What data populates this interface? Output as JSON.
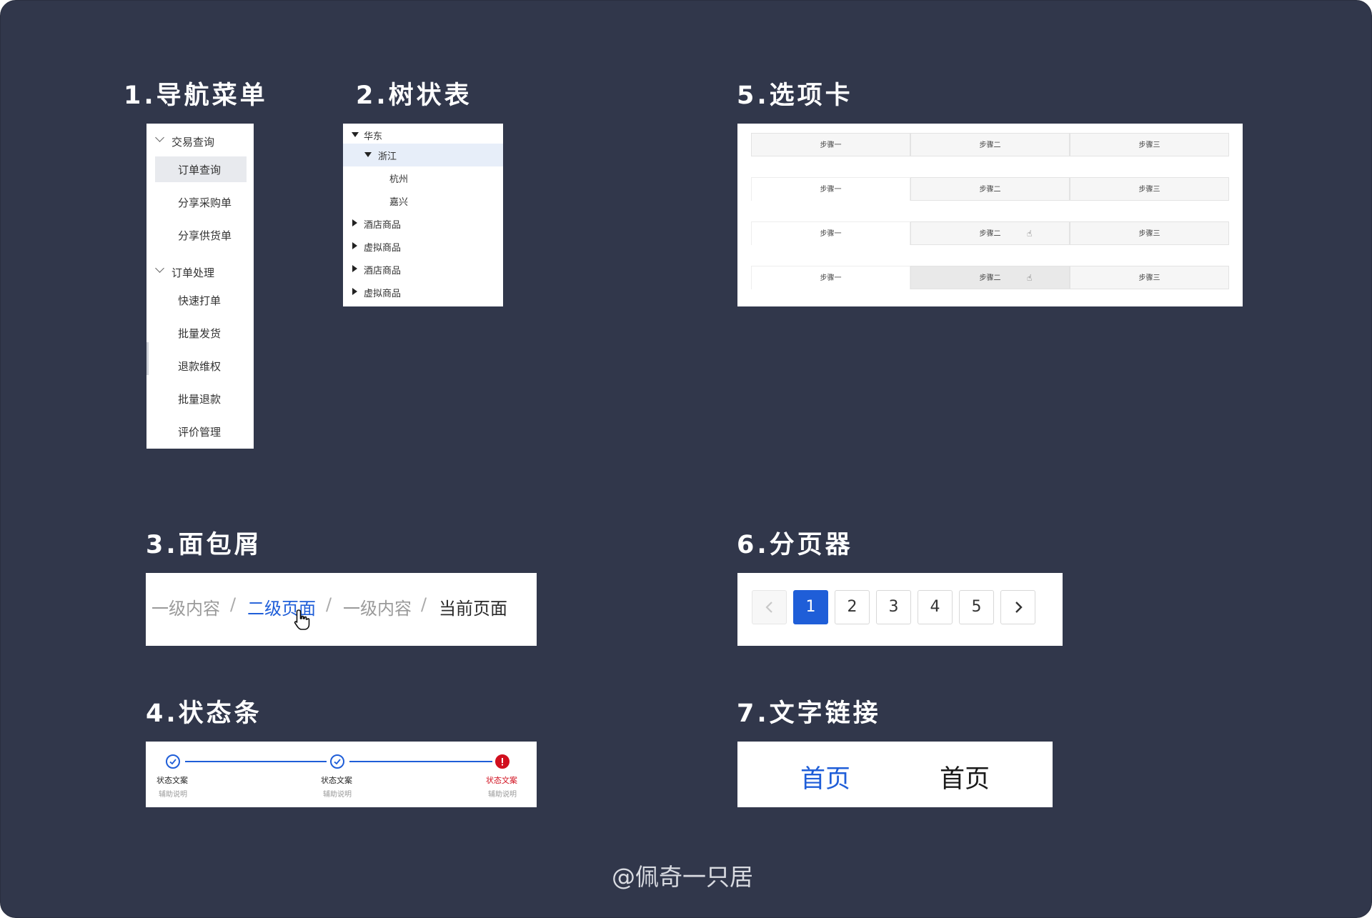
{
  "headings": {
    "nav": "1.导航菜单",
    "tree": "2.树状表",
    "breadcrumb": "3.面包屑",
    "steps": "4.状态条",
    "tabs": "5.选项卡",
    "pager": "6.分页器",
    "links": "7.文字链接"
  },
  "nav": {
    "groups": [
      "交易查询",
      "订单处理"
    ],
    "items": [
      "订单查询",
      "分享采购单",
      "分享供货单",
      "快速打单",
      "批量发货",
      "退款维权",
      "批量退款",
      "评价管理"
    ]
  },
  "tree": [
    "华东",
    "浙江",
    "杭州",
    "嘉兴",
    "酒店商品",
    "虚拟商品",
    "酒店商品",
    "虚拟商品"
  ],
  "tabs": {
    "labels": [
      "步骤一",
      "步骤二",
      "步骤三"
    ]
  },
  "breadcrumb": {
    "items": [
      "一级内容",
      "二级页面",
      "一级内容",
      "当前页面"
    ],
    "separator": "/"
  },
  "steps": [
    {
      "title": "状态文案",
      "sub": "辅助说明"
    },
    {
      "title": "状态文案",
      "sub": "辅助说明"
    },
    {
      "title": "状态文案",
      "sub": "辅助说明"
    }
  ],
  "pager": {
    "pages": [
      "1",
      "2",
      "3",
      "4",
      "5"
    ],
    "current": 1
  },
  "links": [
    "首页",
    "首页"
  ],
  "colors": {
    "background": "#31374b",
    "accent": "#1f5ed8",
    "error": "#d10f1e"
  },
  "credit": "@佩奇一只居"
}
